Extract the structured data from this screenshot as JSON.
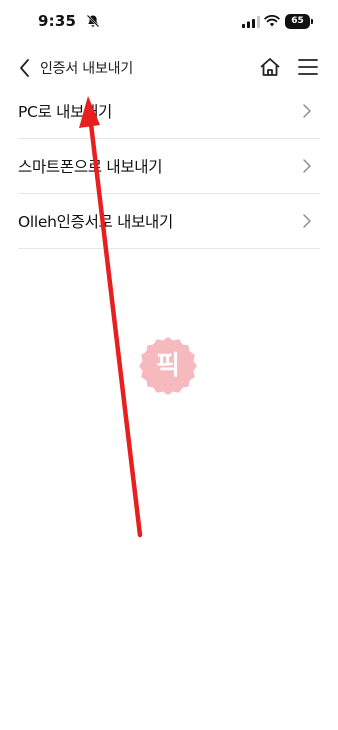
{
  "status_bar": {
    "time": "9:35",
    "battery": "65",
    "icons": [
      "bell-slash-icon",
      "signal-icon",
      "wifi-icon",
      "battery-icon"
    ]
  },
  "nav": {
    "title": "인증서 내보내기",
    "back_icon": "chevron-left-icon",
    "home_icon": "home-icon",
    "menu_icon": "hamburger-menu-icon"
  },
  "export_options": [
    {
      "label": "PC로 내보내기"
    },
    {
      "label": "스마트폰으로 내보내기"
    },
    {
      "label": "Olleh인증서로 내보내기"
    }
  ],
  "watermark": {
    "text": "픽",
    "color": "#f6b9bd"
  },
  "annotation": {
    "color": "#e81f1f"
  }
}
